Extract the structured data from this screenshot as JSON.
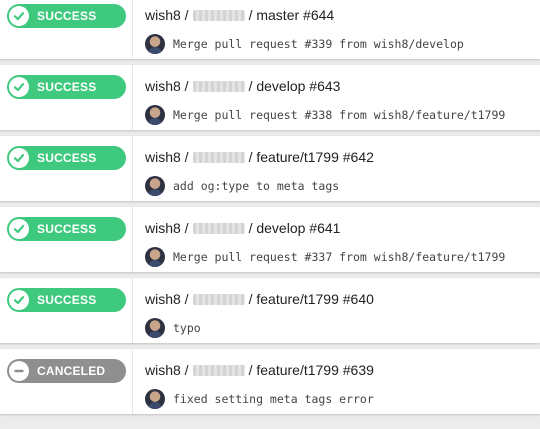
{
  "colors": {
    "success": "#3fc97f",
    "canceled": "#8f8f8f"
  },
  "builds": [
    {
      "status": "SUCCESS",
      "status_icon": "check-icon",
      "owner": "wish8 /",
      "branch_build": "/ master #644",
      "message": "Merge pull request #339 from wish8/develop"
    },
    {
      "status": "SUCCESS",
      "status_icon": "check-icon",
      "owner": "wish8 /",
      "branch_build": "/ develop #643",
      "message": "Merge pull request #338 from wish8/feature/t1799"
    },
    {
      "status": "SUCCESS",
      "status_icon": "check-icon",
      "owner": "wish8 /",
      "branch_build": "/ feature/t1799 #642",
      "message": "add og:type to meta tags"
    },
    {
      "status": "SUCCESS",
      "status_icon": "check-icon",
      "owner": "wish8 /",
      "branch_build": "/ develop #641",
      "message": "Merge pull request #337 from wish8/feature/t1799"
    },
    {
      "status": "SUCCESS",
      "status_icon": "check-icon",
      "owner": "wish8 /",
      "branch_build": "/ feature/t1799 #640",
      "message": "typo"
    },
    {
      "status": "CANCELED",
      "status_icon": "minus-circle-icon",
      "owner": "wish8 /",
      "branch_build": "/ feature/t1799 #639",
      "message": "fixed setting meta tags error"
    }
  ]
}
